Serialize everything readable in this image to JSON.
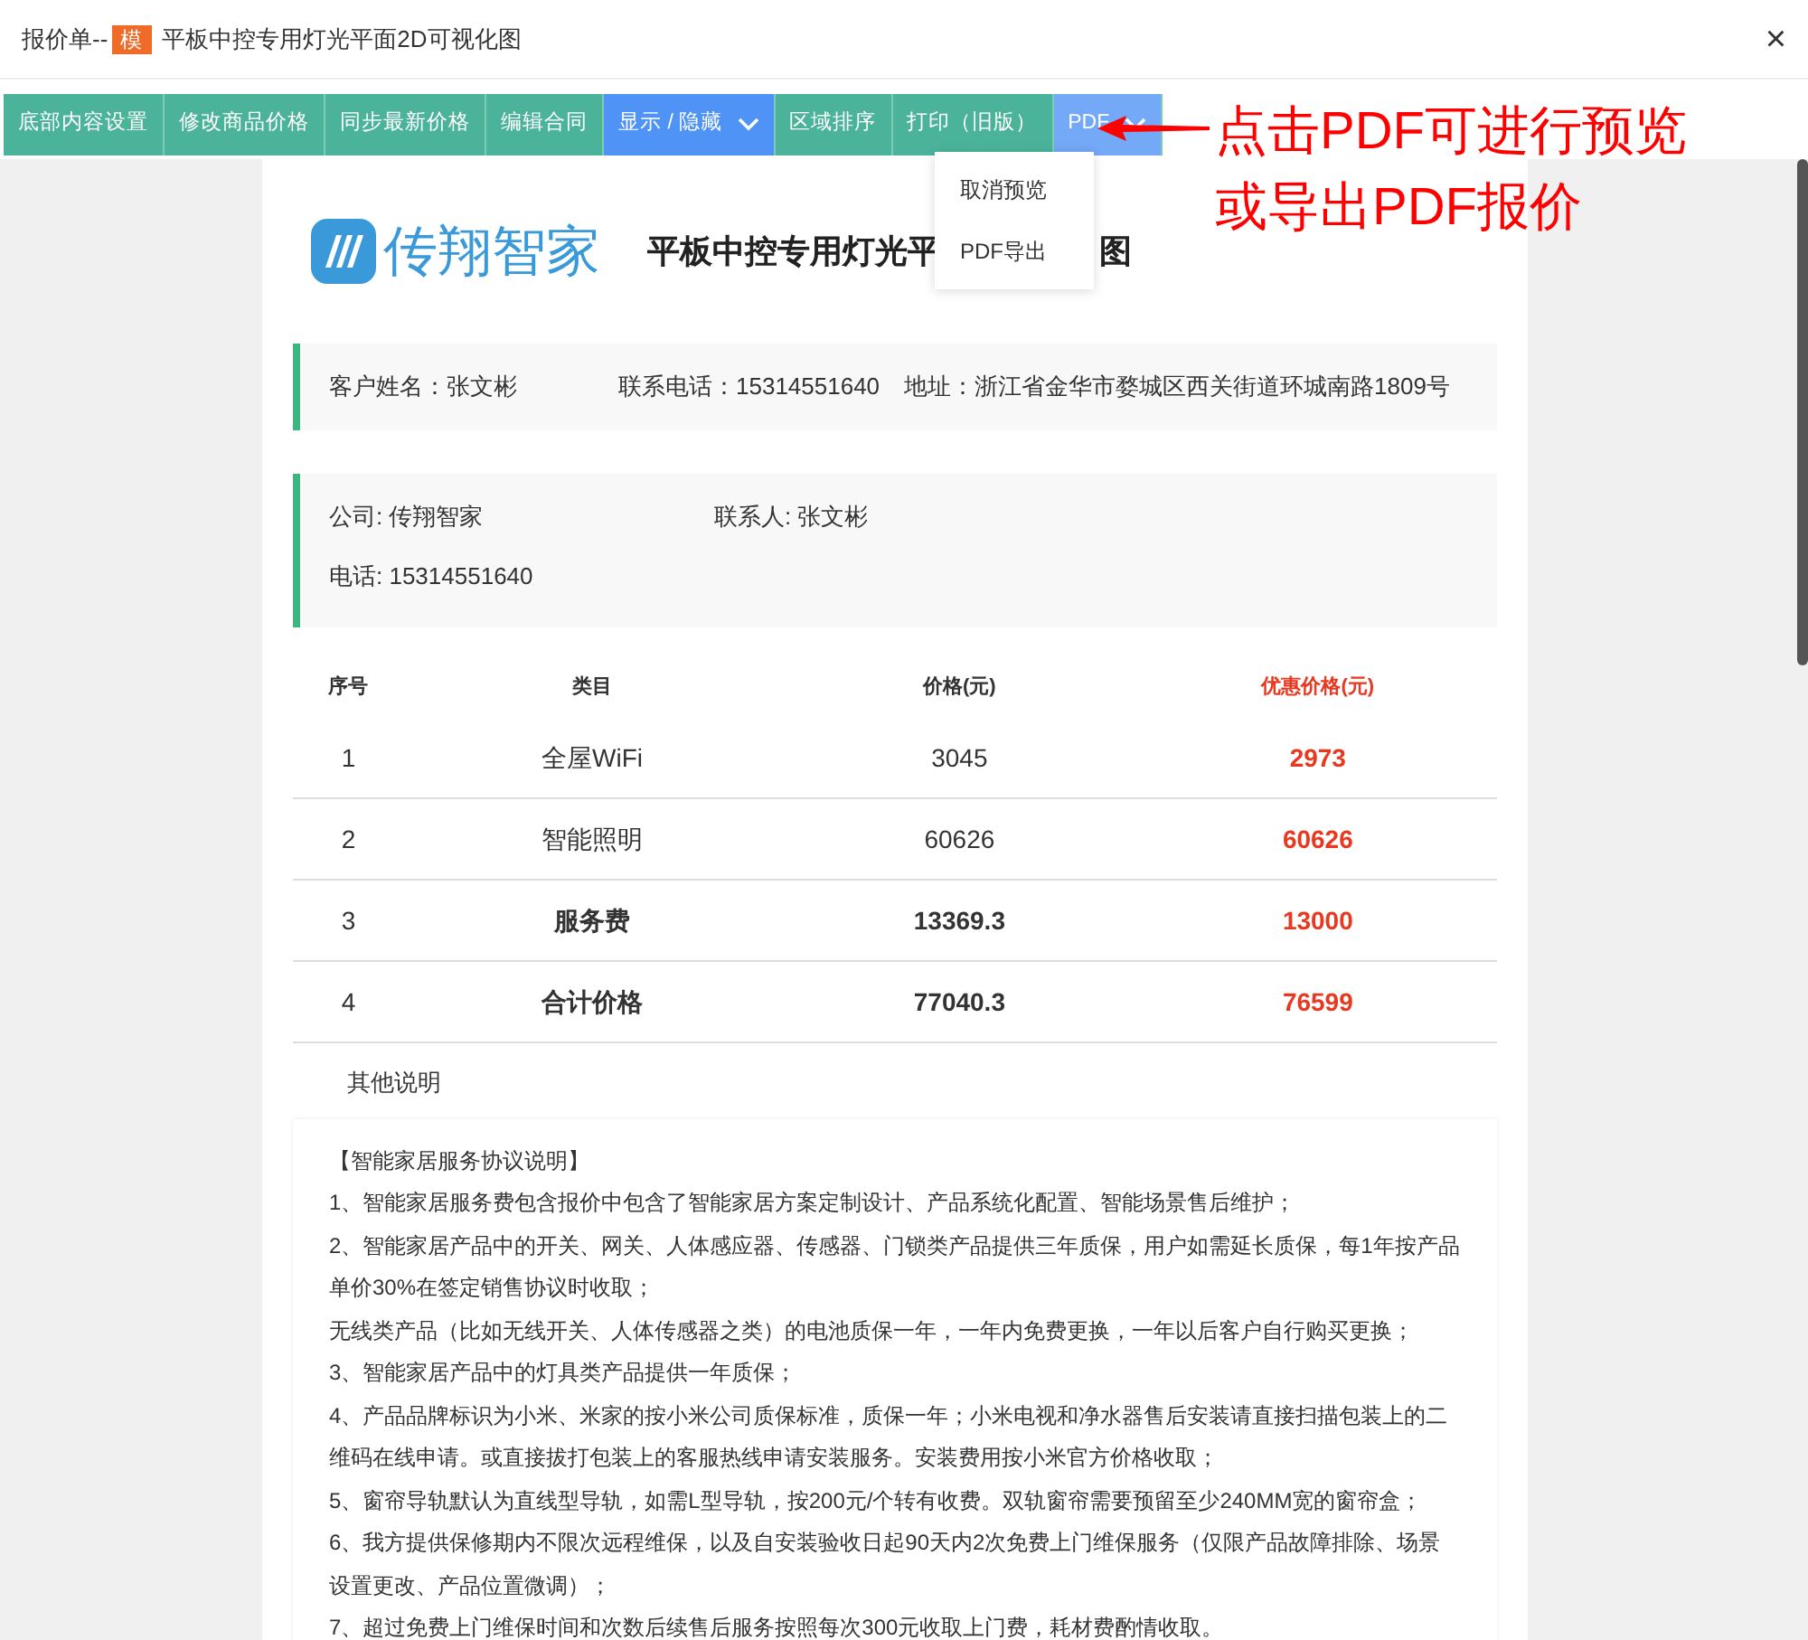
{
  "window": {
    "title_prefix": "报价单--",
    "title_badge": "模",
    "title": "平板中控专用灯光平面2D可视化图",
    "close": "×"
  },
  "toolbar": [
    {
      "label": "底部内容设置",
      "kind": "plain"
    },
    {
      "label": "修改商品价格",
      "kind": "plain"
    },
    {
      "label": "同步最新价格",
      "kind": "plain"
    },
    {
      "label": "编辑合同",
      "kind": "plain"
    },
    {
      "label": "显示 / 隐藏",
      "kind": "dropdown",
      "open": false
    },
    {
      "label": "区域排序",
      "kind": "plain"
    },
    {
      "label": "打印（旧版）",
      "kind": "plain"
    },
    {
      "label": "PDF",
      "kind": "dropdown",
      "open": true
    }
  ],
  "dropdown_menu": [
    "取消预览",
    "PDF导出"
  ],
  "annotation": [
    "点击PDF可进行预览",
    "或导出PDF报价"
  ],
  "document": {
    "brand": "传翔智家",
    "title_parts": [
      "平板中控专用灯光平",
      "图"
    ],
    "customer": [
      "客户姓名：张文彬",
      "联系电话：15314551640",
      "地址：浙江省金华市婺城区西关街道环城南路1809号"
    ],
    "company": [
      "公司: 传翔智家",
      "联系人: 张文彬",
      "电话: 15314551640"
    ],
    "table": {
      "columns": [
        "序号",
        "类目",
        "价格(元)",
        "优惠价格(元)"
      ],
      "rows": [
        {
          "cells": [
            "1",
            "全屋WiFi",
            "3045",
            "2973"
          ],
          "bold": false
        },
        {
          "cells": [
            "2",
            "智能照明",
            "60626",
            "60626"
          ],
          "bold": false
        },
        {
          "cells": [
            "3",
            "服务费",
            "13369.3",
            "13000"
          ],
          "bold": true
        },
        {
          "cells": [
            "4",
            "合计价格",
            "77040.3",
            "76599"
          ],
          "bold": true
        }
      ]
    },
    "notes_title": "其他说明",
    "notes": [
      "【智能家居服务协议说明】",
      "1、智能家居服务费包含报价中包含了智能家居方案定制设计、产品系统化配置、智能场景售后维护；",
      "2、智能家居产品中的开关、网关、人体感应器、传感器、门锁类产品提供三年质保，用户如需延长质保，每1年按产品单价30%在签定销售协议时收取；",
      "无线类产品（比如无线开关、人体传感器之类）的电池质保一年，一年内免费更换，一年以后客户自行购买更换；",
      "3、智能家居产品中的灯具类产品提供一年质保；",
      "4、产品品牌标识为小米、米家的按小米公司质保标准，质保一年；小米电视和净水器售后安装请直接扫描包装上的二维码在线申请。或直接拔打包装上的客服热线申请安装服务。安装费用按小米官方价格收取；",
      "5、窗帘导轨默认为直线型导轨，如需L型导轨，按200元/个转有收费。双轨窗帘需要预留至少240MM宽的窗帘盒；",
      "6、我方提供保修期内不限次远程维保，以及自安装验收日起90天内2次免费上门维保服务（仅限产品故障排除、场景设置更改、产品位置微调）；",
      "7、超过免费上门维保时间和次数后续售后服务按照每次300元收取上门费，耗材费酌情收取。"
    ]
  }
}
